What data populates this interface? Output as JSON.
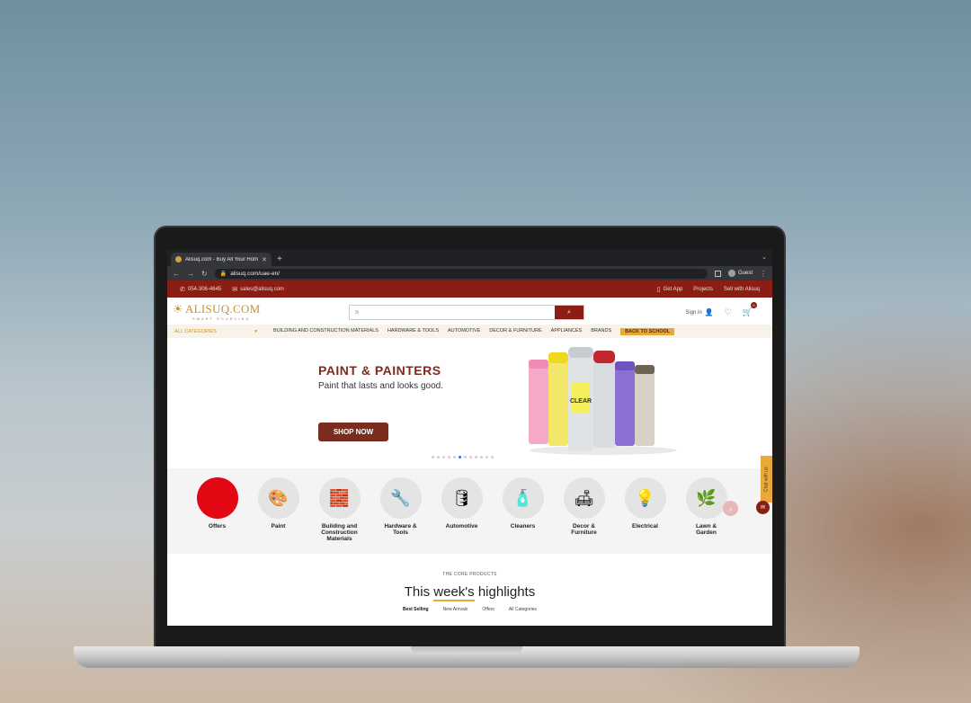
{
  "browser": {
    "tab_title": "Alisuq.com - Buy All Your Hom",
    "url": "alisuq.com/uae-en/",
    "profile": "Guest"
  },
  "topbar": {
    "phone": "054-306-4645",
    "email": "sales@alisuq.com",
    "get_app": "Get App",
    "projects": "Projects",
    "sell": "Sell with Alisuq"
  },
  "header": {
    "logo": "ALISUQ.COM",
    "logo_sub": "SMART SOURCING",
    "search_placeholder": "S",
    "signin": "Sign in"
  },
  "cart_count": "0",
  "catnav": {
    "all_categories": "ALL CATEGORIES",
    "links": [
      "BUILDING AND CONSTRUCTION MATERIALS",
      "HARDWARE & TOOLS",
      "AUTOMOTIVE",
      "DECOR & FURNITURE",
      "APPLIANCES",
      "BRANDS"
    ],
    "back_to_school": "BACK TO SCHOOL"
  },
  "hero": {
    "title": "PAINT & PAINTERS",
    "subtitle": "Paint that lasts and looks good.",
    "cta": "SHOP NOW",
    "slides": 12,
    "active_slide": 5
  },
  "categories": [
    {
      "label": "Offers"
    },
    {
      "label": "Paint"
    },
    {
      "label": "Building and Construction Materials"
    },
    {
      "label": "Hardware & Tools"
    },
    {
      "label": "Automotive"
    },
    {
      "label": "Cleaners"
    },
    {
      "label": "Decor & Furniture"
    },
    {
      "label": "Electrical"
    },
    {
      "label": "Lawn & Garden"
    }
  ],
  "chat_label": "Chat with us",
  "highlights": {
    "eyebrow": "THE CORE PRODUCTS",
    "title_pre": "This ",
    "title_em": "week's",
    "title_post": " highlights",
    "tabs": [
      "Best Selling",
      "New Arrivals",
      "Offers",
      "All Categories"
    ]
  }
}
